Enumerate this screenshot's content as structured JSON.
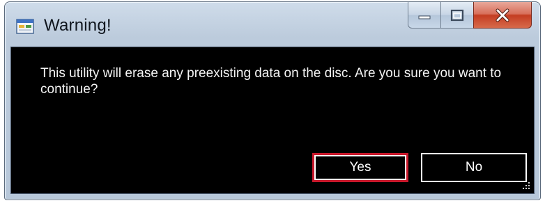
{
  "window": {
    "title": "Warning!",
    "icon": "app-form-icon",
    "caption_buttons": [
      "minimize-icon",
      "maximize-icon",
      "close-icon"
    ]
  },
  "dialog": {
    "message": "This utility will erase any preexisting data on the disc. Are you sure you want to continue?",
    "yes_label": "Yes",
    "no_label": "No",
    "default_button": "Yes"
  },
  "colors": {
    "content_background": "#000000",
    "text": "#ffffff",
    "default_button_border": "#c8182b",
    "close_button": "#c43d22"
  }
}
